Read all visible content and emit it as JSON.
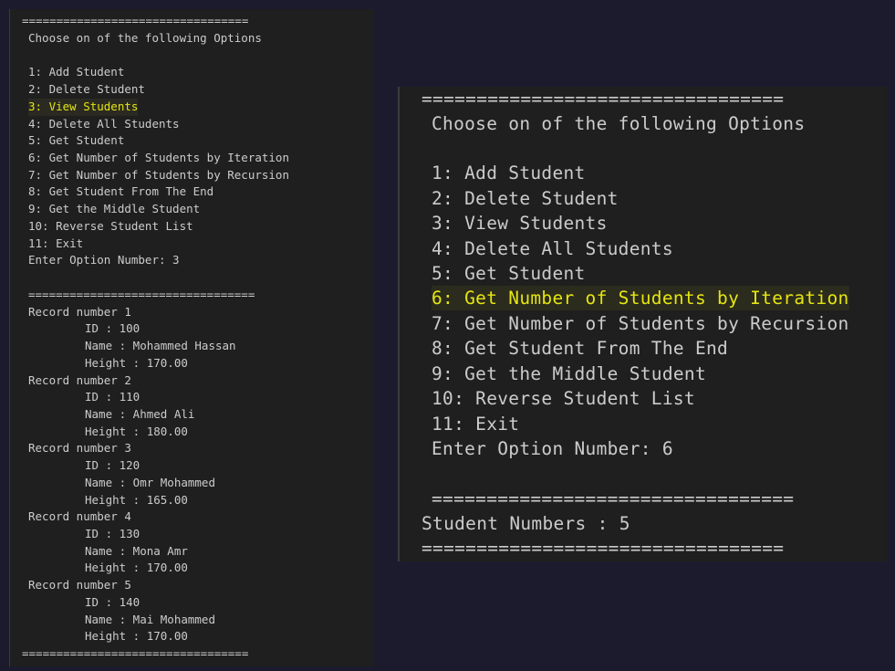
{
  "left_terminal": {
    "separator_top": "=================================",
    "prompt_title": "Choose on of the following Options",
    "menu": [
      "1: Add Student",
      "2: Delete Student",
      "3: View Students",
      "4: Delete All Students",
      "5: Get Student",
      "6: Get Number of Students by Iteration",
      "7: Get Number of Students by Recursion",
      "8: Get Student From The End",
      "9: Get the Middle Student",
      "10: Reverse Student List",
      "11: Exit"
    ],
    "highlighted_index": 2,
    "enter_option": "Enter Option Number: 3",
    "separator_mid": "=================================",
    "records": [
      {
        "header": "Record number 1",
        "id": "ID : 100",
        "name": "Name : Mohammed Hassan",
        "height": "Height : 170.00"
      },
      {
        "header": "Record number 2",
        "id": "ID : 110",
        "name": "Name : Ahmed Ali",
        "height": "Height : 180.00"
      },
      {
        "header": "Record number 3",
        "id": "ID : 120",
        "name": "Name : Omr Mohammed",
        "height": "Height : 165.00"
      },
      {
        "header": "Record number 4",
        "id": "ID : 130",
        "name": "Name : Mona Amr",
        "height": "Height : 170.00"
      },
      {
        "header": "Record number 5",
        "id": "ID : 140",
        "name": "Name : Mai Mohammed",
        "height": "Height : 170.00"
      }
    ],
    "separator_bottom": "================================="
  },
  "right_terminal": {
    "separator_top": "=================================",
    "prompt_title": "Choose on of the following Options",
    "menu": [
      "1: Add Student",
      "2: Delete Student",
      "3: View Students",
      "4: Delete All Students",
      "5: Get Student",
      "6: Get Number of Students by Iteration",
      "7: Get Number of Students by Recursion",
      "8: Get Student From The End",
      "9: Get the Middle Student",
      "10: Reverse Student List",
      "11: Exit"
    ],
    "highlighted_index": 5,
    "enter_option": "Enter Option Number: 6",
    "separator_mid": "=================================",
    "result": "Student Numbers : 5",
    "separator_bottom": "================================="
  },
  "colors": {
    "background": "#1c1b2e",
    "terminal_bg": "#1f1f1f",
    "text": "#cccccc",
    "highlight": "#e5e510"
  }
}
